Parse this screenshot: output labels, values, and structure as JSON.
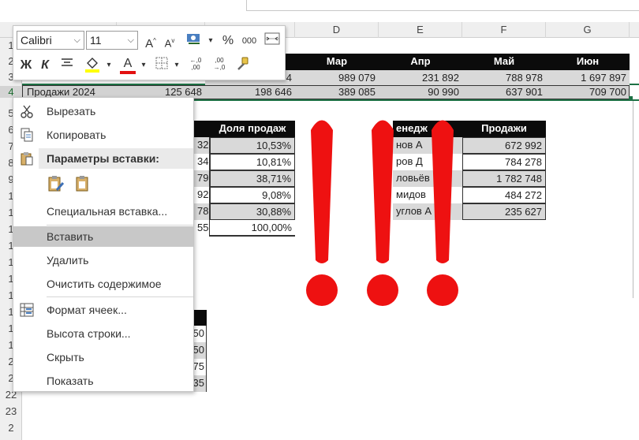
{
  "columns": [
    "D",
    "E",
    "F",
    "G"
  ],
  "rows": [
    "1",
    "2",
    "3",
    "4",
    "5",
    "6",
    "7",
    "8",
    "9",
    "10",
    "11",
    "12",
    "13",
    "14",
    "15",
    "16",
    "17",
    "18",
    "19",
    "20",
    "21",
    "22",
    "23",
    "24"
  ],
  "row_labels_visible": [
    "1",
    "2",
    "3",
    "4",
    "5",
    "6",
    "7",
    "8",
    "9",
    "1",
    "1",
    "1",
    "1",
    "1",
    "1",
    "1",
    "1",
    "1",
    "1",
    "2",
    "2",
    "22",
    "23",
    "2"
  ],
  "month_header": {
    "c": "Мар",
    "d": "Апр",
    "e": "Май",
    "f": "Июн",
    "prev": "4"
  },
  "row3": {
    "prev": "4",
    "mar": "989 079",
    "apr": "231 892",
    "may": "788 978",
    "jun": "1 697 897"
  },
  "row4": {
    "label": "Продажи 2024",
    "b": "125 648",
    "c": "198 646",
    "mar": "389 085",
    "apr": "90 990",
    "may": "637 901",
    "jun": "709 700"
  },
  "table_left": {
    "header": "Доля продаж",
    "cut_values": [
      "32",
      "34",
      "79",
      "92",
      "78",
      "55"
    ],
    "shares": [
      "10,53%",
      "10,81%",
      "38,71%",
      "9,08%",
      "30,88%",
      "100,00%"
    ]
  },
  "table_right": {
    "header_manager": "енедж",
    "header_sales": "Продажи",
    "names": [
      "нов А",
      "ров Д",
      "ловьёв",
      "мидов",
      "углов А"
    ],
    "sales": [
      "672 992",
      "784 278",
      "1 782 748",
      "484 272",
      "235 627"
    ]
  },
  "table_bottom": {
    "values": [
      "50",
      "50",
      "75",
      "35"
    ]
  },
  "exclamation_color": "#ee1111",
  "toolbar": {
    "font_name": "Calibri",
    "font_size": "11",
    "grow_font": "A",
    "shrink_font": "A",
    "percent": "%",
    "thousands": "000",
    "bold": "Ж",
    "italic": "К",
    "font_color_letter": "A",
    "increase_decimal": "←,0\n,00",
    "decrease_decimal": ",00\n→,0"
  },
  "menu": {
    "cut": "Вырезать",
    "copy": "Копировать",
    "paste_options": "Параметры вставки:",
    "paste_special": "Специальная вставка...",
    "insert": "Вставить",
    "delete": "Удалить",
    "clear": "Очистить содержимое",
    "format_cells": "Формат ячеек...",
    "row_height": "Высота строки...",
    "hide": "Скрыть",
    "unhide": "Показать"
  }
}
